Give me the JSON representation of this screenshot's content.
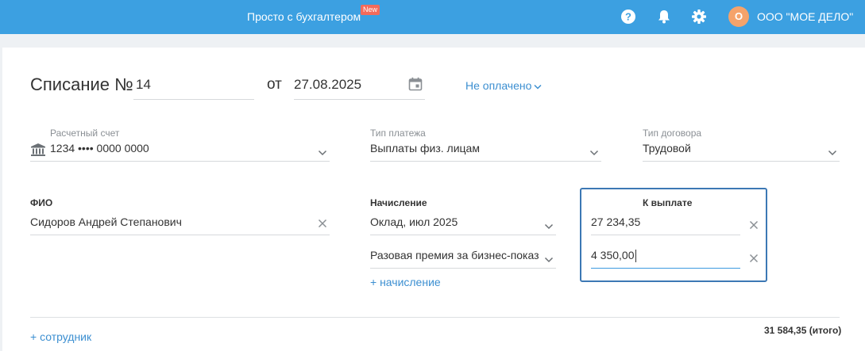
{
  "header": {
    "title": "Просто с бухгалтером",
    "badge": "New",
    "avatar_letter": "О",
    "org_name": "ООО \"МОЕ ДЕЛО\"",
    "icons": [
      "help-icon",
      "bell-icon",
      "gear-icon"
    ]
  },
  "doc": {
    "title": "Списание №",
    "number": "14",
    "date_prefix": "от",
    "date": "27.08.2025",
    "status": "Не оплачено"
  },
  "fields": {
    "account_label": "Расчетный счет",
    "account_value": "1234 •••• 0000 0000",
    "payment_type_label": "Тип платежа",
    "payment_type_value": "Выплаты физ. лицам",
    "contract_type_label": "Тип договора",
    "contract_type_value": "Трудовой"
  },
  "employee": {
    "fio_label": "ФИО",
    "fio_value": "Сидоров Андрей Степанович",
    "accrual_label": "Начисление",
    "payout_label": "К выплате",
    "accruals": [
      {
        "name": "Оклад, июл 2025",
        "amount": "27 234,35"
      },
      {
        "name": "Разовая премия за бизнес-показ",
        "amount": "4 350,00"
      }
    ],
    "add_accrual": "+ начисление"
  },
  "footer": {
    "add_employee": "+ сотрудник",
    "total": "31 584,35 (итого)"
  },
  "colors": {
    "header_bg": "#3ca0e1",
    "accent": "#3c8fd1",
    "badge": "#f36b5b",
    "avatar": "#f5a36b",
    "payout_border": "#3c78b4"
  }
}
